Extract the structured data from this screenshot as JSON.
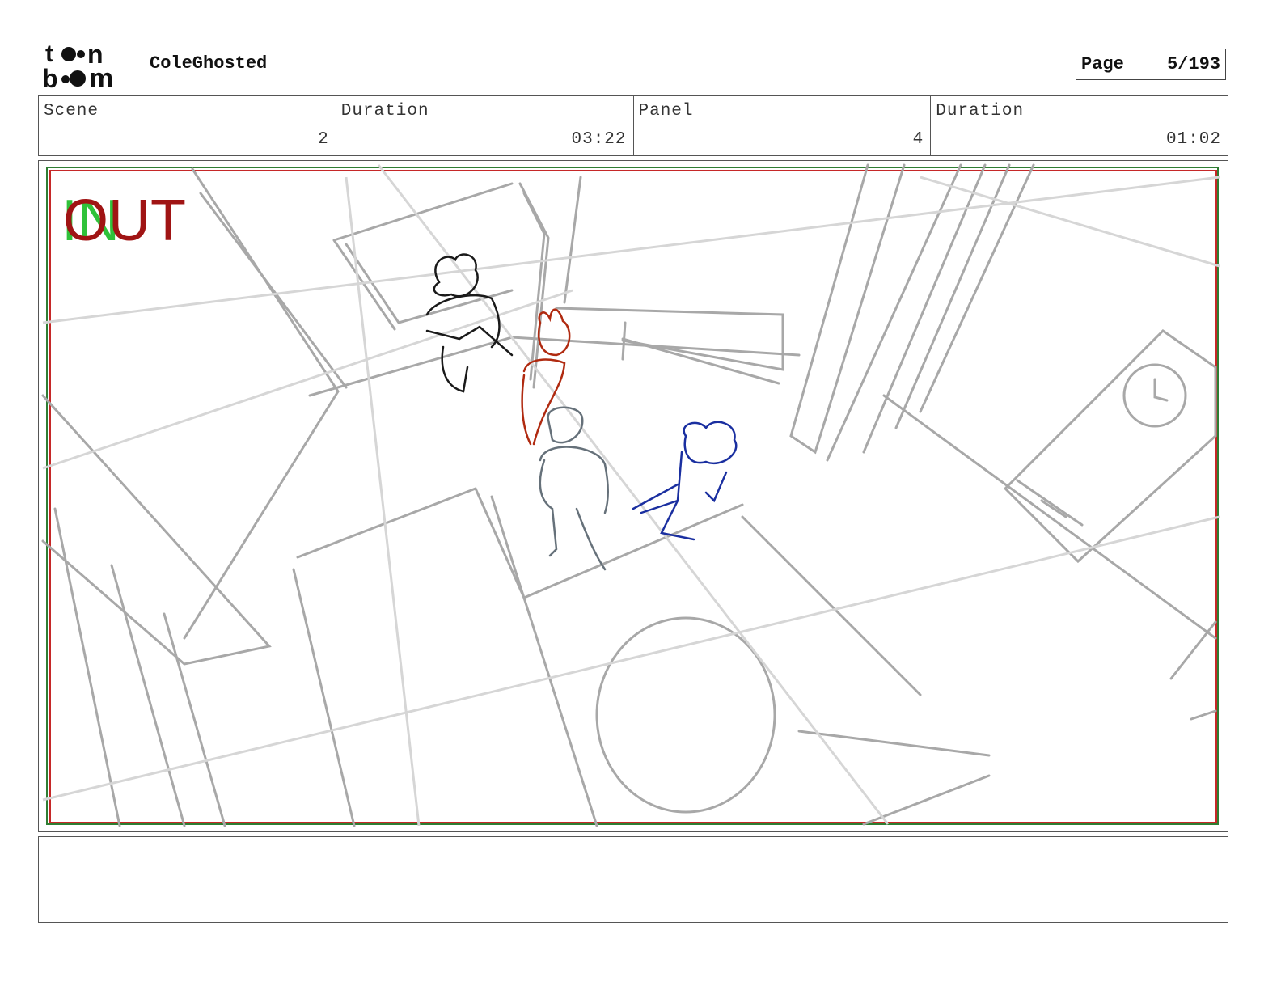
{
  "header": {
    "logo_text": "toon boom",
    "project_title": "ColeGhosted",
    "page_label": "Page",
    "page_number": "5/193"
  },
  "info": {
    "scene_label": "Scene",
    "scene_value": "2",
    "scene_duration_label": "Duration",
    "scene_duration_value": "03:22",
    "panel_label": "Panel",
    "panel_value": "4",
    "panel_duration_label": "Duration",
    "panel_duration_value": "01:02"
  },
  "panel": {
    "in_marker": "IN",
    "out_marker": "OUT"
  },
  "notes": {
    "text": ""
  },
  "colors": {
    "in_marker": "#2fc23a",
    "out_marker": "#a01414",
    "sketch_lines": "#9a9a9a",
    "character_black": "#1a1a1a",
    "character_red": "#b02a10",
    "character_gray": "#66717a",
    "character_blue": "#1a2fa0"
  }
}
